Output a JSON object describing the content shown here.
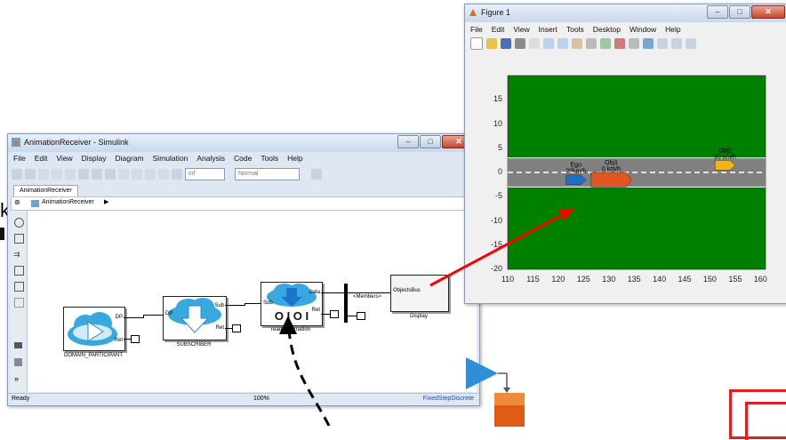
{
  "simulink": {
    "title": "AnimationReceiver - Simulink",
    "menu": [
      "File",
      "Edit",
      "View",
      "Display",
      "Diagram",
      "Simulation",
      "Analysis",
      "Code",
      "Tools",
      "Help"
    ],
    "stop_time": "inf",
    "sim_mode": "Normal",
    "tab": "AnimationReceiver",
    "breadcrumb": "AnimationReceiver",
    "blocks": {
      "domain_participant": {
        "caption": "DOMAIN_PARTICIPANT",
        "port_dp": "DP",
        "port_ret": "Ret"
      },
      "subscriber": {
        "caption": "SUBSCRIBER",
        "port_dp": "DP",
        "port_sub": "Sub",
        "port_ret": "Ret"
      },
      "reader": {
        "caption": "readerAnimation",
        "port_sub": "Sub",
        "port_data": "Data",
        "port_ret": "Ret"
      },
      "bus_label": "<Members>",
      "display": {
        "caption": "Display",
        "port": "ObjectsBus"
      }
    },
    "status": {
      "left": "Ready",
      "center": "100%",
      "right": "FixedStepDiscrete"
    }
  },
  "figure": {
    "title": "Figure 1",
    "menu": [
      "File",
      "Edit",
      "View",
      "Insert",
      "Tools",
      "Desktop",
      "Window",
      "Help"
    ],
    "vehicles": [
      {
        "label": "Ego",
        "speed": "??km/h",
        "color": "#1f6fc6",
        "x": 121.5,
        "y": -1.5,
        "length": 4,
        "width": 2
      },
      {
        "label": "Obj1",
        "speed": "0 km/h",
        "color": "#e2561f",
        "x": 126.5,
        "y": -1.5,
        "length": 8,
        "width": 3
      },
      {
        "label": "Obj2",
        "speed": "90 km/h",
        "color": "#f0b31a",
        "x": 151,
        "y": 1.5,
        "length": 4,
        "width": 2
      }
    ],
    "y_ticks": [
      "15",
      "10",
      "5",
      "0",
      "-5",
      "-10",
      "-15",
      "-20"
    ],
    "x_ticks": [
      "110",
      "115",
      "120",
      "125",
      "130",
      "135",
      "140",
      "145",
      "150",
      "155",
      "160"
    ],
    "colors": {
      "grass": "#008000",
      "road": "#808080",
      "lane_mark": "#ffffff"
    }
  },
  "annotations": {
    "k_glyph": "k",
    "arrow_color": "#ff0000"
  }
}
